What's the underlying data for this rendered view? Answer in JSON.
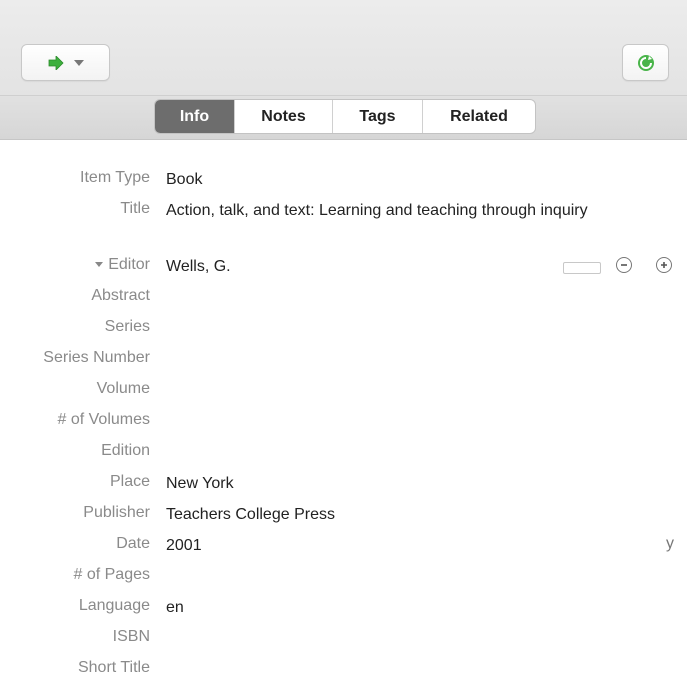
{
  "toolbar": {
    "locate_icon": "green-arrow-icon",
    "dropdown_icon": "chevron-down-icon",
    "sync_icon": "sync-icon"
  },
  "tabs": [
    {
      "label": "Info",
      "active": true
    },
    {
      "label": "Notes",
      "active": false
    },
    {
      "label": "Tags",
      "active": false
    },
    {
      "label": "Related",
      "active": false
    }
  ],
  "fields": [
    {
      "label": "Item Type",
      "value": "Book"
    },
    {
      "label": "Title",
      "value": "Action, talk, and text: Learning and teaching through inquiry"
    },
    {
      "label": "Editor",
      "value": "Wells, G."
    },
    {
      "label": "Abstract",
      "value": ""
    },
    {
      "label": "Series",
      "value": ""
    },
    {
      "label": "Series Number",
      "value": ""
    },
    {
      "label": "Volume",
      "value": ""
    },
    {
      "label": "# of Volumes",
      "value": ""
    },
    {
      "label": "Edition",
      "value": ""
    },
    {
      "label": "Place",
      "value": "New York"
    },
    {
      "label": "Publisher",
      "value": "Teachers College Press"
    },
    {
      "label": "Date",
      "value": "2001",
      "suffix": "y"
    },
    {
      "label": "# of Pages",
      "value": ""
    },
    {
      "label": "Language",
      "value": "en"
    },
    {
      "label": "ISBN",
      "value": ""
    },
    {
      "label": "Short Title",
      "value": ""
    }
  ]
}
